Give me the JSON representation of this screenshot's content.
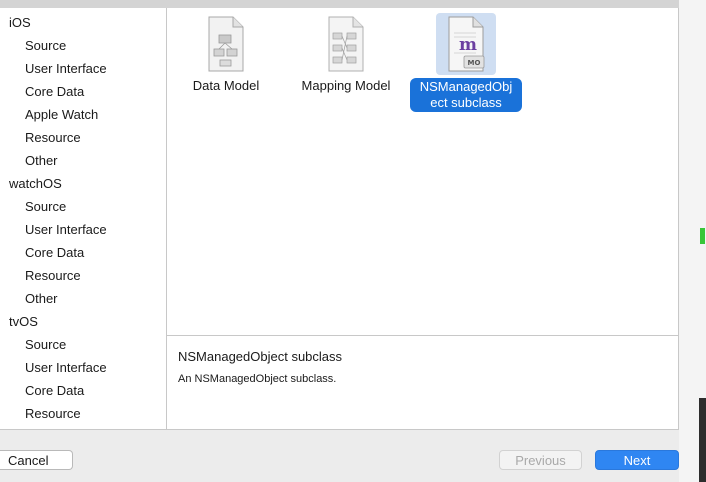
{
  "sidebar": {
    "groups": [
      {
        "title": "iOS",
        "items": [
          "Source",
          "User Interface",
          "Core Data",
          "Apple Watch",
          "Resource",
          "Other"
        ]
      },
      {
        "title": "watchOS",
        "items": [
          "Source",
          "User Interface",
          "Core Data",
          "Resource",
          "Other"
        ]
      },
      {
        "title": "tvOS",
        "items": [
          "Source",
          "User Interface",
          "Core Data",
          "Resource"
        ]
      }
    ]
  },
  "templates": [
    {
      "label": "Data Model",
      "icon": "data-model-doc-icon",
      "selected": false
    },
    {
      "label": "Mapping Model",
      "icon": "mapping-model-doc-icon",
      "selected": false
    },
    {
      "label": "NSManagedObject subclass",
      "label_line1": "NSManagedObj",
      "label_line2": "ect subclass",
      "icon": "managed-object-doc-icon",
      "badge_letter": "m",
      "badge_text": "MO",
      "selected": true
    }
  ],
  "details": {
    "title": "NSManagedObject subclass",
    "description": "An NSManagedObject subclass."
  },
  "buttons": {
    "cancel": "Cancel",
    "previous": "Previous",
    "next": "Next"
  },
  "colors": {
    "selection": "#1a72d9",
    "primary_button": "#2f86f2"
  }
}
